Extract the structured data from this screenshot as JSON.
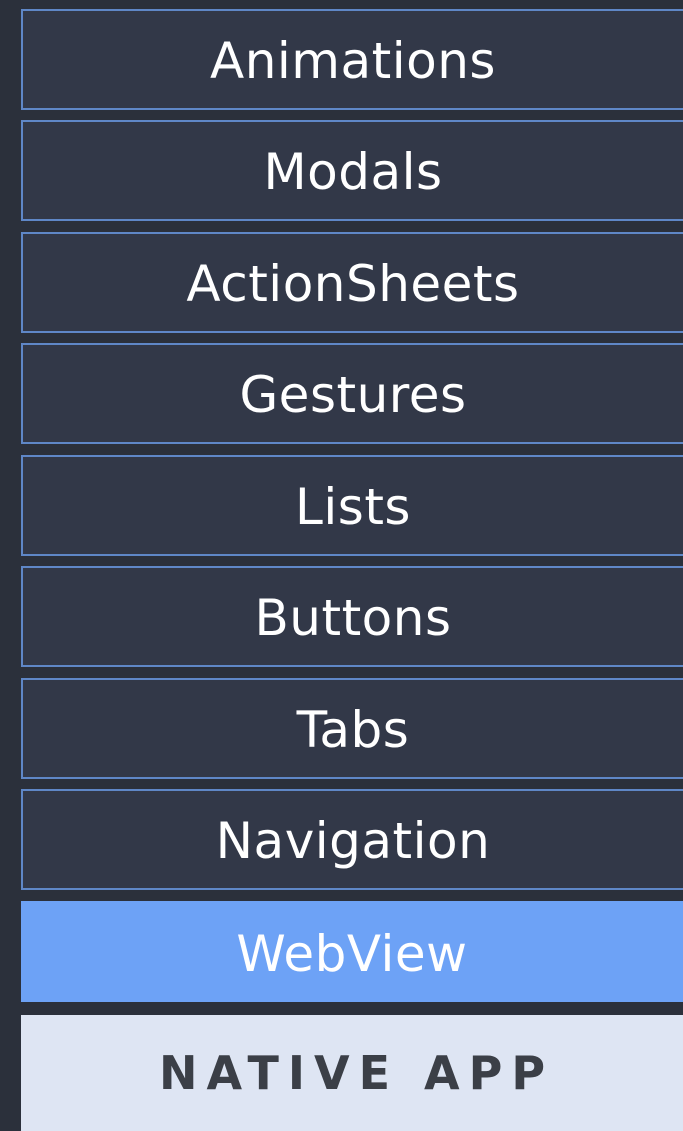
{
  "menu": {
    "items": [
      {
        "label": "Animations"
      },
      {
        "label": "Modals"
      },
      {
        "label": "ActionSheets"
      },
      {
        "label": "Gestures"
      },
      {
        "label": "Lists"
      },
      {
        "label": "Buttons"
      },
      {
        "label": "Tabs"
      },
      {
        "label": "Navigation"
      },
      {
        "label": "WebView",
        "active": true
      }
    ]
  },
  "footer": {
    "label": "NATIVE APP"
  },
  "colors": {
    "background": "#2b303b",
    "item_background": "#323848",
    "item_border": "#5f87c7",
    "active_background": "#6da2f6",
    "footer_background": "#dee5f3",
    "footer_text": "#3b3f47"
  }
}
